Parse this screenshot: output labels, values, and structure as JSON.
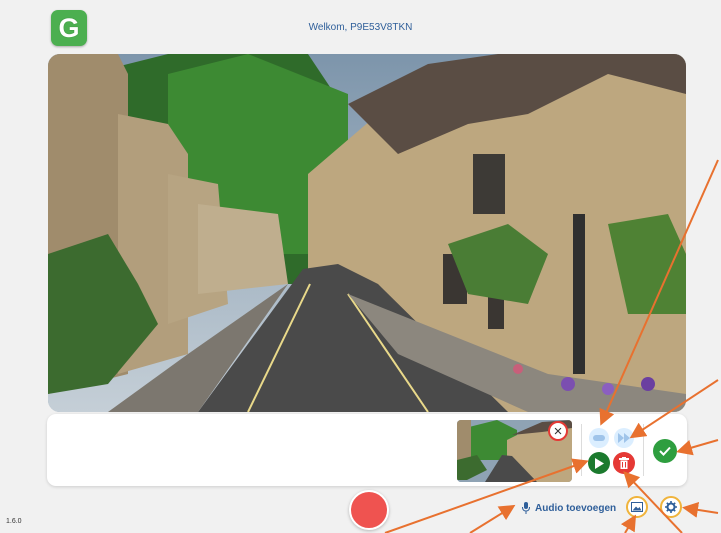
{
  "header": {
    "logo_letter": "G",
    "welcome_text": "Welkom, P9E53V8TKN"
  },
  "toolbar": {
    "audio_label": "Audio toevoegen",
    "version": "1.6.0"
  },
  "icons": {
    "close": "×",
    "confirm": "check-icon",
    "play": "play-icon",
    "delete": "trash-icon",
    "record": "record-icon",
    "image": "image-icon",
    "settings": "gear-icon",
    "mic": "microphone-icon"
  },
  "colors": {
    "accent_blue": "#2f5f9a",
    "green": "#2e9e3f",
    "red": "#e53935",
    "record": "#ef5350",
    "annotation": "#e8712f"
  }
}
